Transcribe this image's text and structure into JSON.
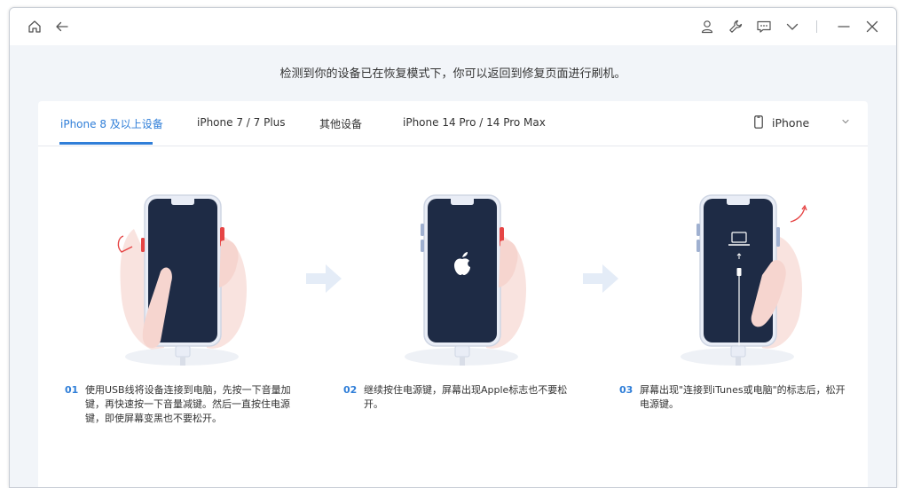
{
  "titlebar": {
    "icons": [
      "home-icon",
      "back-icon",
      "user-icon",
      "wrench-icon",
      "message-icon",
      "chevron-down-icon",
      "minimize-icon",
      "close-icon"
    ]
  },
  "notice": "检测到你的设备已在恢复模式下，你可以返回到修复页面进行刷机。",
  "tabs": [
    {
      "label": "iPhone 8 及以上设备",
      "active": true
    },
    {
      "label": "iPhone 7 / 7 Plus",
      "active": false
    },
    {
      "label": "其他设备",
      "active": false
    },
    {
      "label": "iPhone 14 Pro / 14 Pro Max",
      "active": false
    }
  ],
  "device_select": {
    "value": "iPhone"
  },
  "steps": [
    {
      "num": "01",
      "lines": [
        "使用USB线将设备连接到电脑，先按一下音量加",
        "键，再快速按一下音量减键。然后一直按住电源",
        "键，即使屏幕变黑也不要松开。"
      ]
    },
    {
      "num": "02",
      "lines": [
        "继续按住电源键，屏幕出现Apple标志也不要松",
        "开。"
      ]
    },
    {
      "num": "03",
      "lines": [
        "屏幕出现\"连接到iTunes或电脑\"的标志后，松开",
        "电源键。"
      ]
    }
  ],
  "colors": {
    "accent": "#2f7ed8",
    "screen": "#1e2b45",
    "button_highlight": "#e64545",
    "background": "#f2f5f9"
  }
}
